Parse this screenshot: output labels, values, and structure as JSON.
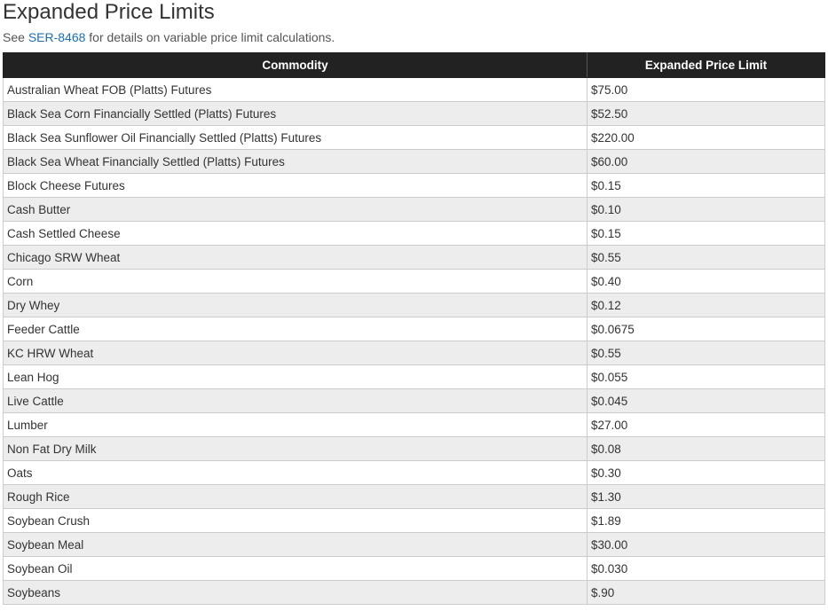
{
  "page": {
    "title": "Expanded Price Limits",
    "intro_prefix": "See ",
    "intro_link": "SER-8468",
    "intro_suffix": " for details on variable price limit calculations."
  },
  "table": {
    "headers": [
      "Commodity",
      "Expanded Price Limit"
    ],
    "rows": [
      [
        "Australian Wheat FOB (Platts) Futures",
        "$75.00"
      ],
      [
        "Black Sea Corn Financially Settled (Platts) Futures",
        "$52.50"
      ],
      [
        "Black Sea Sunflower Oil Financially Settled (Platts) Futures",
        "$220.00"
      ],
      [
        "Black Sea Wheat Financially Settled (Platts) Futures",
        "$60.00"
      ],
      [
        "Block Cheese Futures",
        "$0.15"
      ],
      [
        "Cash Butter",
        "$0.10"
      ],
      [
        "Cash Settled Cheese",
        "$0.15"
      ],
      [
        "Chicago SRW Wheat",
        "$0.55"
      ],
      [
        "Corn",
        "$0.40"
      ],
      [
        "Dry Whey",
        "$0.12"
      ],
      [
        "Feeder Cattle",
        "$0.0675"
      ],
      [
        "KC HRW Wheat",
        "$0.55"
      ],
      [
        "Lean Hog",
        "$0.055"
      ],
      [
        "Live Cattle",
        "$0.045"
      ],
      [
        "Lumber",
        "$27.00"
      ],
      [
        "Non Fat Dry Milk",
        "$0.08"
      ],
      [
        "Oats",
        "$0.30"
      ],
      [
        "Rough Rice",
        "$1.30"
      ],
      [
        "Soybean Crush",
        "$1.89"
      ],
      [
        "Soybean Meal",
        "$30.00"
      ],
      [
        "Soybean Oil",
        "$0.030"
      ],
      [
        "Soybeans",
        "$.90"
      ]
    ]
  },
  "colors": {
    "header_bg": "#222222",
    "header_text": "#ffffff",
    "stripe": "#ededed",
    "link": "#1a6fb3",
    "border": "#cccccc"
  }
}
